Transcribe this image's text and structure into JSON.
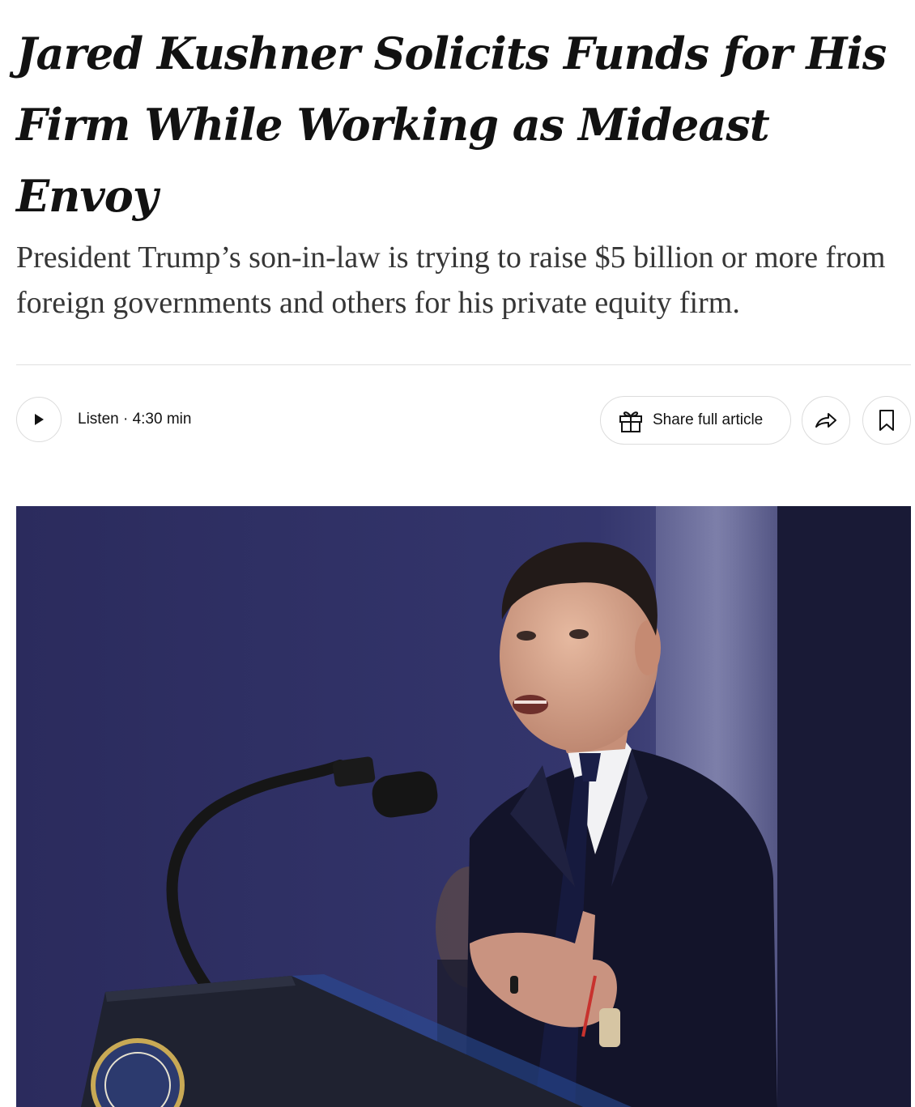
{
  "article": {
    "headline": "Jared Kushner Solicits Funds for His Firm While Working as Mideast Envoy",
    "summary": "President Trump’s son-in-law is trying to raise $5 billion or more from foreign governments and others for his private equity firm."
  },
  "toolbar": {
    "listen_label": "Listen · 4:30 min",
    "share_label": "Share full article"
  },
  "icons": {
    "play": "play-icon",
    "gift": "gift-icon",
    "forward": "share-arrow-icon",
    "bookmark": "bookmark-icon"
  },
  "colors": {
    "text": "#121212",
    "summary": "#363636",
    "border": "#dcdcdc",
    "photo_background": "#2b2c5e"
  }
}
